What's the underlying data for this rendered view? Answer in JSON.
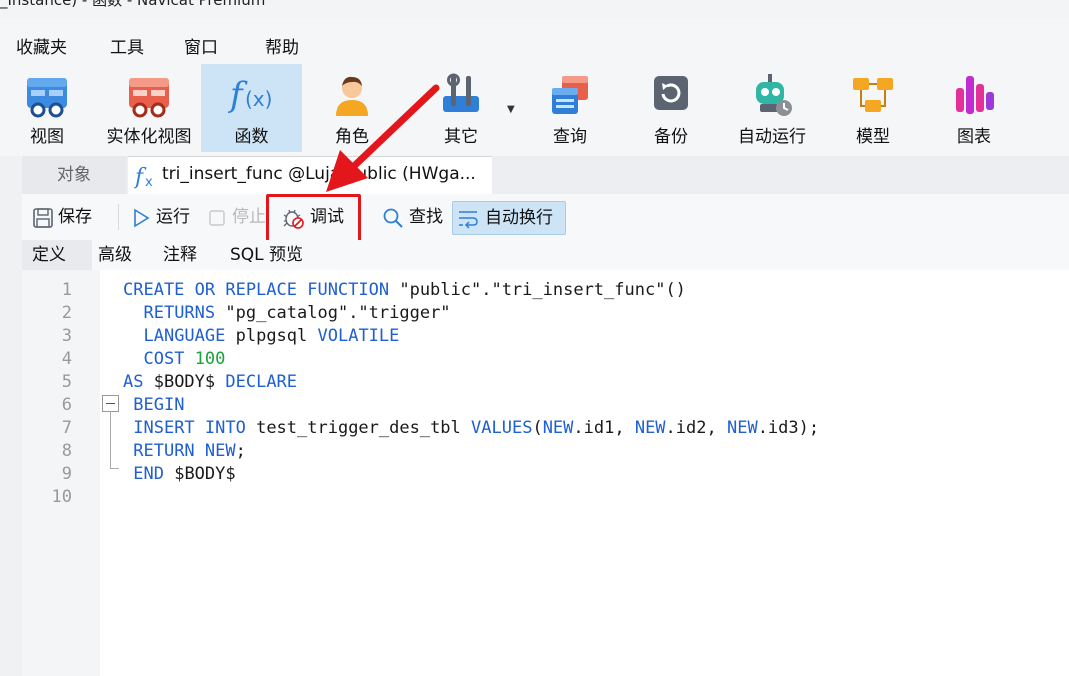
{
  "window": {
    "title": "_Instance) - 函数 - Navicat Premium"
  },
  "menu": [
    "收藏夹",
    "工具",
    "窗口",
    "帮助"
  ],
  "ribbon": [
    {
      "label": "视图",
      "icon": "view-icon"
    },
    {
      "label": "实体化视图",
      "icon": "materialized-view-icon"
    },
    {
      "label": "函数",
      "icon": "function-icon",
      "active": true
    },
    {
      "label": "角色",
      "icon": "role-icon"
    },
    {
      "label": "其它",
      "icon": "others-icon"
    },
    {
      "label": "查询",
      "icon": "query-icon"
    },
    {
      "label": "备份",
      "icon": "backup-icon"
    },
    {
      "label": "自动运行",
      "icon": "automation-icon"
    },
    {
      "label": "模型",
      "icon": "model-icon"
    },
    {
      "label": "图表",
      "icon": "chart-icon"
    }
  ],
  "tabs": {
    "objects": "对象",
    "function_tab": "tri_insert_func @Luja.public (HWga..."
  },
  "toolbar": {
    "save": "保存",
    "run": "运行",
    "stop": "停止",
    "debug": "调试",
    "find": "查找",
    "wrap": "自动换行"
  },
  "subtabs": [
    "定义",
    "高级",
    "注释",
    "SQL 预览"
  ],
  "editor": {
    "line_numbers": [
      "1",
      "2",
      "3",
      "4",
      "5",
      "6",
      "7",
      "8",
      "9",
      "10"
    ]
  },
  "colors": {
    "keyword": "#1f5fd1",
    "number": "#19a33a",
    "annotation": "#e3161b",
    "active_bg": "#cde4f7"
  }
}
